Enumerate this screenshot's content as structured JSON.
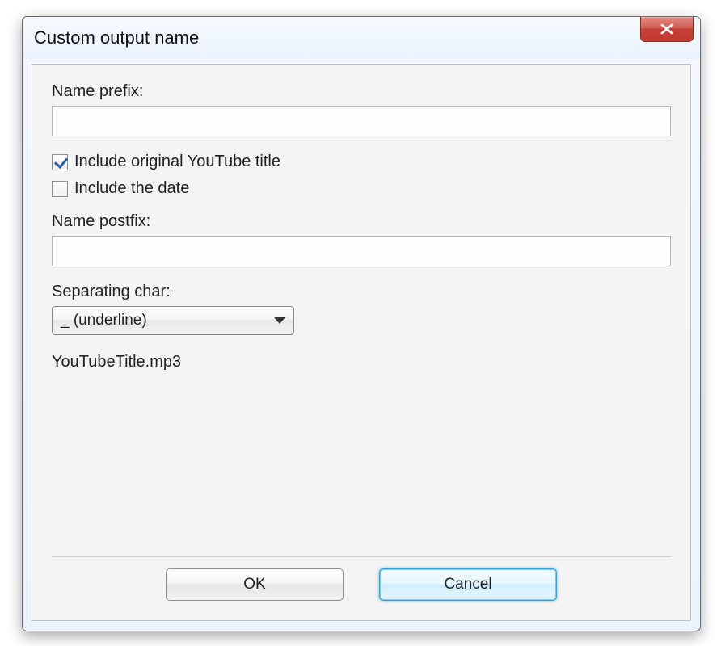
{
  "window": {
    "title": "Custom output name"
  },
  "fields": {
    "name_prefix_label": "Name prefix:",
    "name_prefix_value": "",
    "name_postfix_label": "Name postfix:",
    "name_postfix_value": "",
    "separating_char_label": "Separating char:",
    "separating_char_value": "_ (underline)"
  },
  "checkboxes": {
    "include_title": {
      "label": "Include original YouTube title",
      "checked": true
    },
    "include_date": {
      "label": "Include the date",
      "checked": false
    }
  },
  "preview": "YouTubeTitle.mp3",
  "buttons": {
    "ok": "OK",
    "cancel": "Cancel",
    "focused": "cancel"
  }
}
